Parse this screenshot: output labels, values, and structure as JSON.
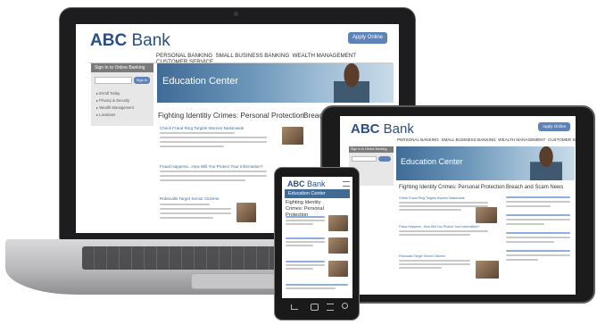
{
  "brand": {
    "logo_abc": "ABC",
    "logo_bank": "Bank"
  },
  "header": {
    "apply_label": "Apply Online"
  },
  "nav": [
    "PERSONAL BANKING",
    "SMALL BUSINESS BANKING",
    "WEALTH MANAGEMENT",
    "CUSTOMER SERVICE"
  ],
  "signin": {
    "title": "Sign In to Online Banking",
    "button": "Sign In",
    "links": [
      "Enroll Today",
      "Privacy & Security",
      "Wealth Management",
      "Locations"
    ]
  },
  "hero": {
    "title": "Education Center"
  },
  "main": {
    "heading": "Fighting Identity Crimes: Personal Protection",
    "heading_truncated": "Fighting Identitiy Crimes: Personal Protection",
    "side_heading": "Breach and Scam News",
    "side_heading_cut": "Breac",
    "articles": [
      "Check Fraud Ring Targets Women Nationwide",
      "Fraud Happens...How Will You Protect Your Information?",
      "Robocalls Target Senior Citizens"
    ]
  },
  "mobile": {
    "hero_title": "Education Center",
    "heading": "Fighting Identity Crimes: Personal Protection"
  },
  "colors": {
    "brand_blue": "#2a4f86",
    "button_blue": "#5d83b8",
    "link_blue": "#3a6fa8"
  }
}
